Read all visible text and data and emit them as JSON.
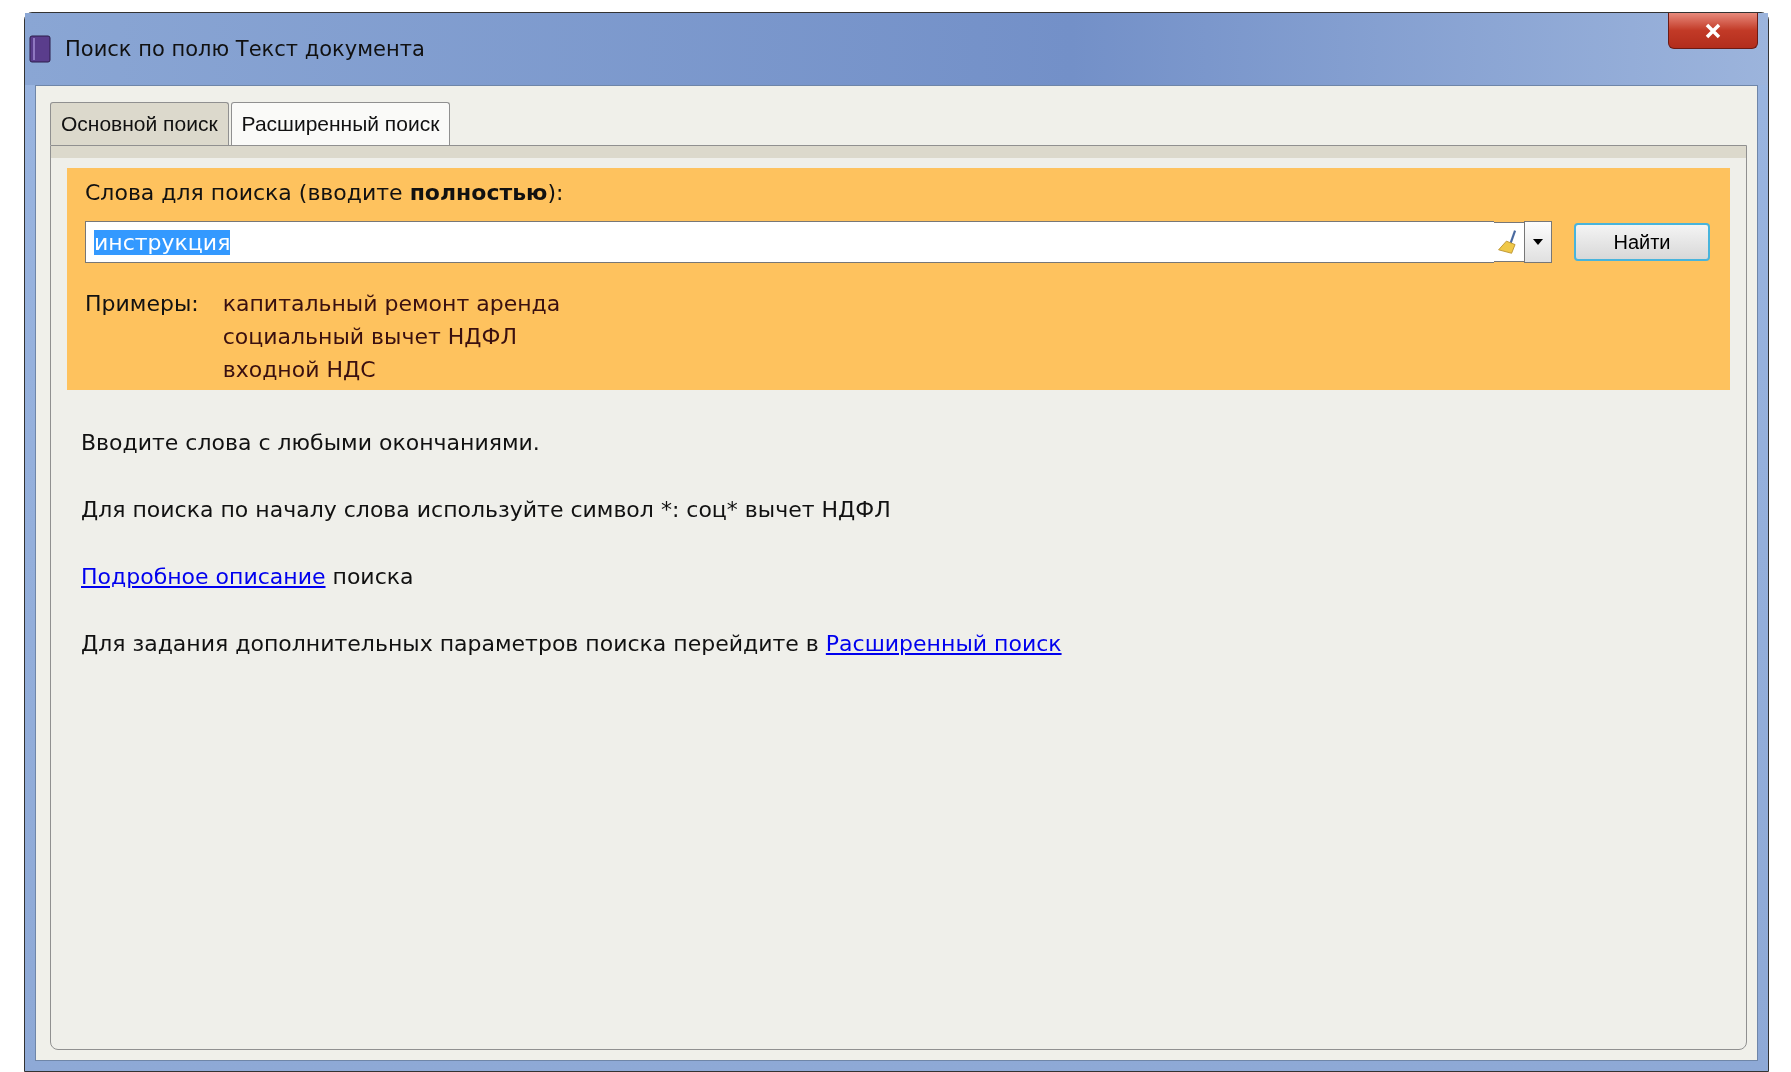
{
  "window": {
    "title": "Поиск по полю Текст документа"
  },
  "tabs": [
    {
      "label": "Основной поиск",
      "selected": true
    },
    {
      "label": "Расширенный поиск",
      "selected": false
    }
  ],
  "search": {
    "label": "Слова для поиска (вводите **полностью**):",
    "value": "инструкция",
    "value_highlighted": true,
    "button": "Найти"
  },
  "examples": {
    "label": "Примеры:",
    "items": [
      "капитальный ремонт аренда",
      "социальный вычет НДФЛ",
      "входной НДС"
    ]
  },
  "help": [
    {
      "kind": "text",
      "text": "Вводите слова с любыми окончаниями."
    },
    {
      "kind": "text",
      "text": "Для поиска по началу слова используйте символ *: соц* вычет НДФЛ"
    },
    {
      "kind": "link_first",
      "link": "Подробное описание",
      "text": "поиска"
    },
    {
      "kind": "link_last",
      "text": "Для задания дополнительных параметров поиска перейдите в",
      "link": "Расширенный поиск"
    }
  ]
}
